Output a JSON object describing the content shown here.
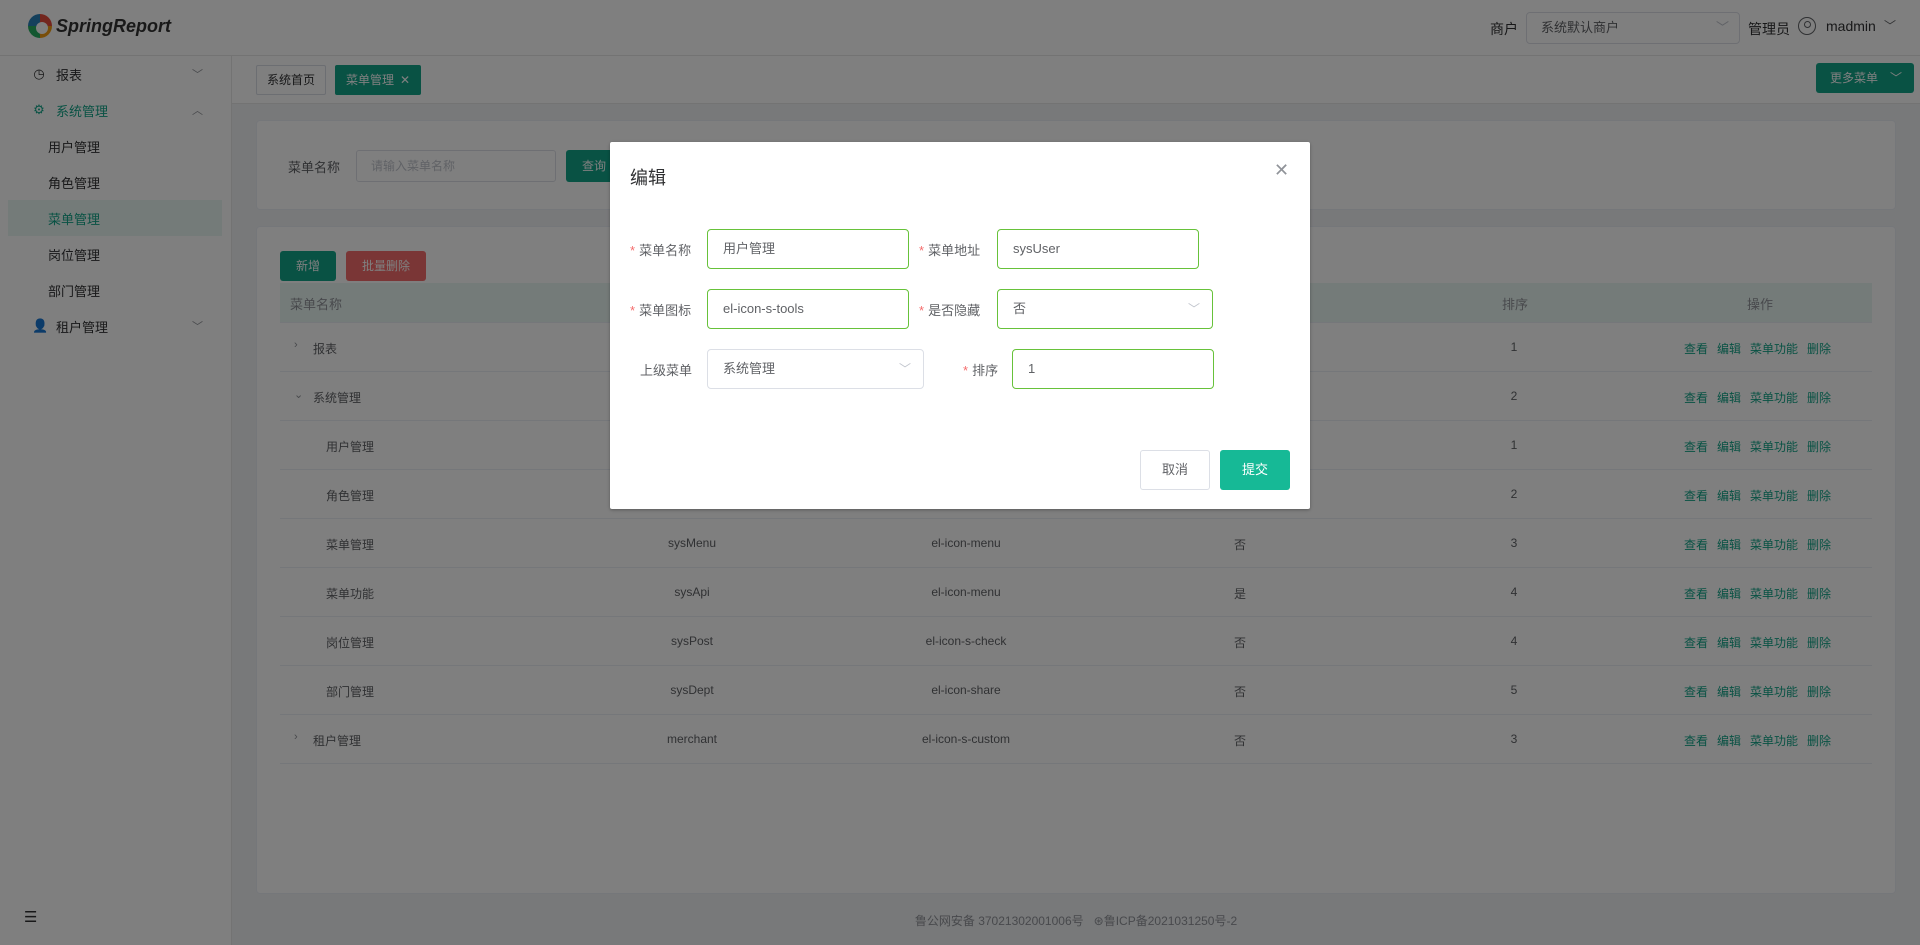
{
  "header": {
    "logo_text": "SpringReport",
    "merchant_label": "商户",
    "merchant_value": "系统默认商户",
    "role_label": "管理员",
    "username": "madmin"
  },
  "sidebar": {
    "items": [
      {
        "label": "报表"
      },
      {
        "label": "系统管理"
      },
      {
        "label": "用户管理"
      },
      {
        "label": "角色管理"
      },
      {
        "label": "菜单管理"
      },
      {
        "label": "岗位管理"
      },
      {
        "label": "部门管理"
      },
      {
        "label": "租户管理"
      }
    ]
  },
  "tabs": [
    {
      "label": "系统首页"
    },
    {
      "label": "菜单管理"
    }
  ],
  "more_menu_label": "更多菜单",
  "search": {
    "label": "菜单名称",
    "placeholder": "请输入菜单名称",
    "query_label": "查询"
  },
  "toolbar": {
    "add_label": "新增",
    "batch_delete_label": "批量删除"
  },
  "table": {
    "columns": {
      "name": "菜单名称",
      "sort": "排序",
      "ops": "操作"
    },
    "ops": [
      "查看",
      "编辑",
      "菜单功能",
      "删除"
    ],
    "rows": [
      {
        "name": "报表",
        "url": "",
        "icon": "",
        "hidden": "",
        "sort": "1"
      },
      {
        "name": "系统管理",
        "url": "",
        "icon": "",
        "hidden": "",
        "sort": "2"
      },
      {
        "name": "用户管理",
        "url": "",
        "icon": "",
        "hidden": "",
        "sort": "1"
      },
      {
        "name": "角色管理",
        "url": "",
        "icon": "",
        "hidden": "",
        "sort": "2"
      },
      {
        "name": "菜单管理",
        "url": "sysMenu",
        "icon": "el-icon-menu",
        "hidden": "否",
        "sort": "3"
      },
      {
        "name": "菜单功能",
        "url": "sysApi",
        "icon": "el-icon-menu",
        "hidden": "是",
        "sort": "4"
      },
      {
        "name": "岗位管理",
        "url": "sysPost",
        "icon": "el-icon-s-check",
        "hidden": "否",
        "sort": "4"
      },
      {
        "name": "部门管理",
        "url": "sysDept",
        "icon": "el-icon-share",
        "hidden": "否",
        "sort": "5"
      },
      {
        "name": "租户管理",
        "url": "merchant",
        "icon": "el-icon-s-custom",
        "hidden": "否",
        "sort": "3"
      }
    ]
  },
  "footer": {
    "police": "鲁公网安备 37021302001006号",
    "icp": "鲁ICP备2021031250号-2"
  },
  "dialog": {
    "title": "编辑",
    "fields": {
      "menu_name_label": "菜单名称",
      "menu_name_value": "用户管理",
      "menu_url_label": "菜单地址",
      "menu_url_value": "sysUser",
      "menu_icon_label": "菜单图标",
      "menu_icon_value": "el-icon-s-tools",
      "hidden_label": "是否隐藏",
      "hidden_value": "否",
      "parent_label": "上级菜单",
      "parent_value": "系统管理",
      "sort_label": "排序",
      "sort_value": "1"
    },
    "cancel_label": "取消",
    "submit_label": "提交"
  },
  "colors": {
    "primary": "#13a589",
    "danger": "#f56c6c",
    "valid_border": "#67c23a"
  }
}
